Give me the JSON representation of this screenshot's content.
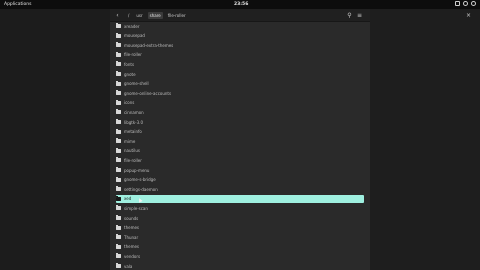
{
  "topbar": {
    "apps_label": "Applications",
    "clock": "23:56"
  },
  "header": {
    "back_icon": "back-arrow-icon",
    "breadcrumbs": [
      "/",
      "usr",
      "share",
      "file-roller"
    ],
    "active_index": 2,
    "search_icon": "search-icon",
    "menu_icon": "menu-icon",
    "close_icon": "close-icon"
  },
  "files": [
    "thumbnailers",
    "mozilla",
    "mousepad-extra-themes",
    "file-roller",
    "fonts",
    "gnote",
    "gnome-shell",
    "gnome-online-accounts",
    "icons",
    "cinnamon",
    "libgtk-3.0",
    "metainfo",
    "mime",
    "nautilus",
    "polkit-1",
    "plymouth",
    "popup-menu",
    "sounds",
    "xdg",
    "Thunar",
    "themes",
    "vala",
    "applications",
    "unity",
    "local",
    "pixmaps"
  ],
  "visible_files": [
    "xreader",
    "mousepad",
    "mousepad-extra-themes",
    "file-roller",
    "fonts",
    "gnote",
    "gnome-shell",
    "gnome-online-accounts",
    "icons",
    "cinnamon",
    "libgtk-3.0",
    "metainfo",
    "mime",
    "nautilus",
    "file-roller",
    "popup-menu",
    "gnome-s-bridge",
    "settings-daemon",
    "xed",
    "simple-scan",
    "sounds",
    "themes",
    "Thunar",
    "themes",
    "vendors",
    "vala"
  ],
  "selected_index": 18
}
